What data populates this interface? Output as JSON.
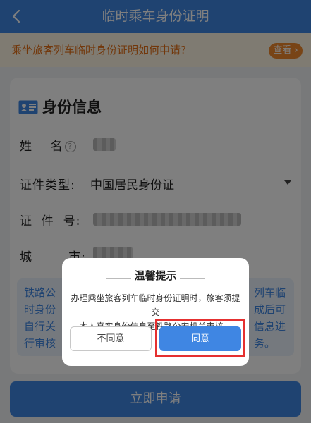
{
  "header": {
    "title": "临时乘车身份证明",
    "back_icon": "chevron-left-icon"
  },
  "notice": {
    "text": "乘坐旅客列车临时身份证明如何申请?",
    "button_label": "查看",
    "button_icon": "chevron-right-icon"
  },
  "card": {
    "title": "身份信息",
    "title_icon": "id-card-icon",
    "fields": {
      "name": {
        "label": "姓    名",
        "help_icon": "question-circle-icon",
        "value_redacted": true
      },
      "id_type": {
        "label": "证件类型:",
        "value": "中国居民身份证",
        "dropdown_icon": "caret-down-icon"
      },
      "id_number": {
        "label": "证  件  号:",
        "value_redacted": true
      },
      "city": {
        "label": "城        市:",
        "value_redacted": true
      }
    },
    "info_lines": [
      "铁路公",
      "时身份",
      "自行关",
      "行审核"
    ],
    "info_lines_right": [
      "列车临",
      "成后可",
      "信息进",
      "务。"
    ]
  },
  "submit_label": "立即申请",
  "dialog": {
    "title": "温馨提示",
    "message_line1": "办理乘坐旅客列车临时身份证明时，旅客须提交",
    "message_line2": "本人真实身份信息至铁路公安机关审核。",
    "disagree_label": "不同意",
    "agree_label": "同意"
  },
  "colors": {
    "primary": "#3f86e3",
    "notice_text": "#e46f15",
    "notice_button": "#f1892c",
    "highlight": "#e53030"
  }
}
